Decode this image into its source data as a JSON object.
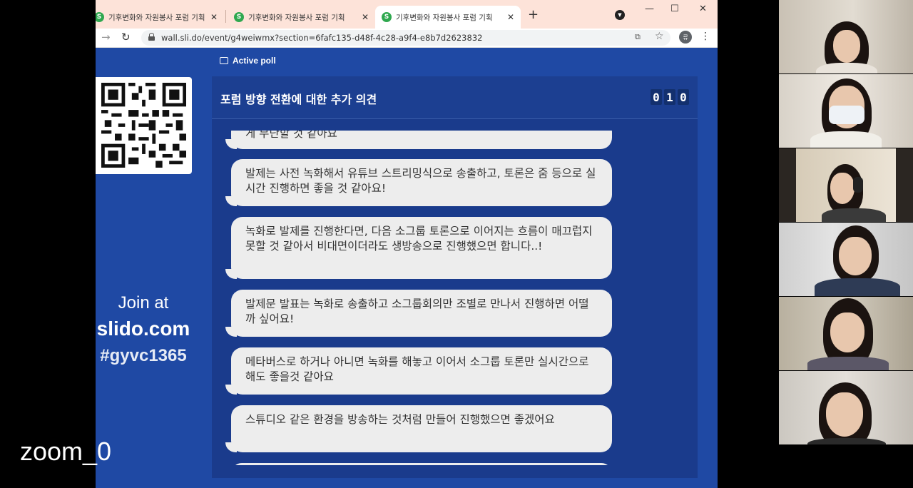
{
  "browser": {
    "tabs": [
      {
        "title": "기후변화와 자원봉사 포럼 기획"
      },
      {
        "title": "기후변화와 자원봉사 포럼 기획"
      },
      {
        "title": "기후변화와 자원봉사 포럼 기획"
      }
    ],
    "favicon_letter": "S",
    "url": "wall.sli.do/event/g4weiwmx?section=6fafc135-d48f-4c28-a9f4-e8b7d2623832",
    "profile_initial": "류"
  },
  "slido": {
    "active_poll_label": "Active poll",
    "join_at": "Join at",
    "join_site": "slido.com",
    "join_code": "#gyvc1365",
    "poll_title": "포럼 방향 전환에 대한 추가 의견",
    "counter": [
      "0",
      "1",
      "0"
    ],
    "responses": [
      {
        "text": "게 무난할 것 같아요"
      },
      {
        "text": "발제는 사전 녹화해서 유튜브 스트리밍식으로 송출하고, 토론은 줌 등으로 실시간 진행하면 좋을 것 같아요!"
      },
      {
        "text": "녹화로 발제를 진행한다면, 다음 소그룹 토론으로 이어지는 흐름이 매끄럽지 못할 것 같아서 비대면이더라도 생방송으로 진행했으면 합니다..!"
      },
      {
        "text": "발제문 발표는 녹화로 송출하고 소그룹회의만 조별로 만나서 진행하면 어떨까 싶어요!"
      },
      {
        "text": "메타버스로 하거나 아니면 녹화를 해놓고 이어서 소그룹 토론만 실시간으로 해도 좋을것 같아요"
      },
      {
        "text": "스튜디오 같은 환경을 방송하는 것처럼 만들어 진행했으면 좋겠어요"
      }
    ]
  },
  "meeting": {
    "recording_label": "zoom_0"
  },
  "colors": {
    "slido_blue": "#1f49a4",
    "panel_blue": "#1a3b8c",
    "bubble": "#ededed",
    "tab_strip": "#fde3d9"
  }
}
